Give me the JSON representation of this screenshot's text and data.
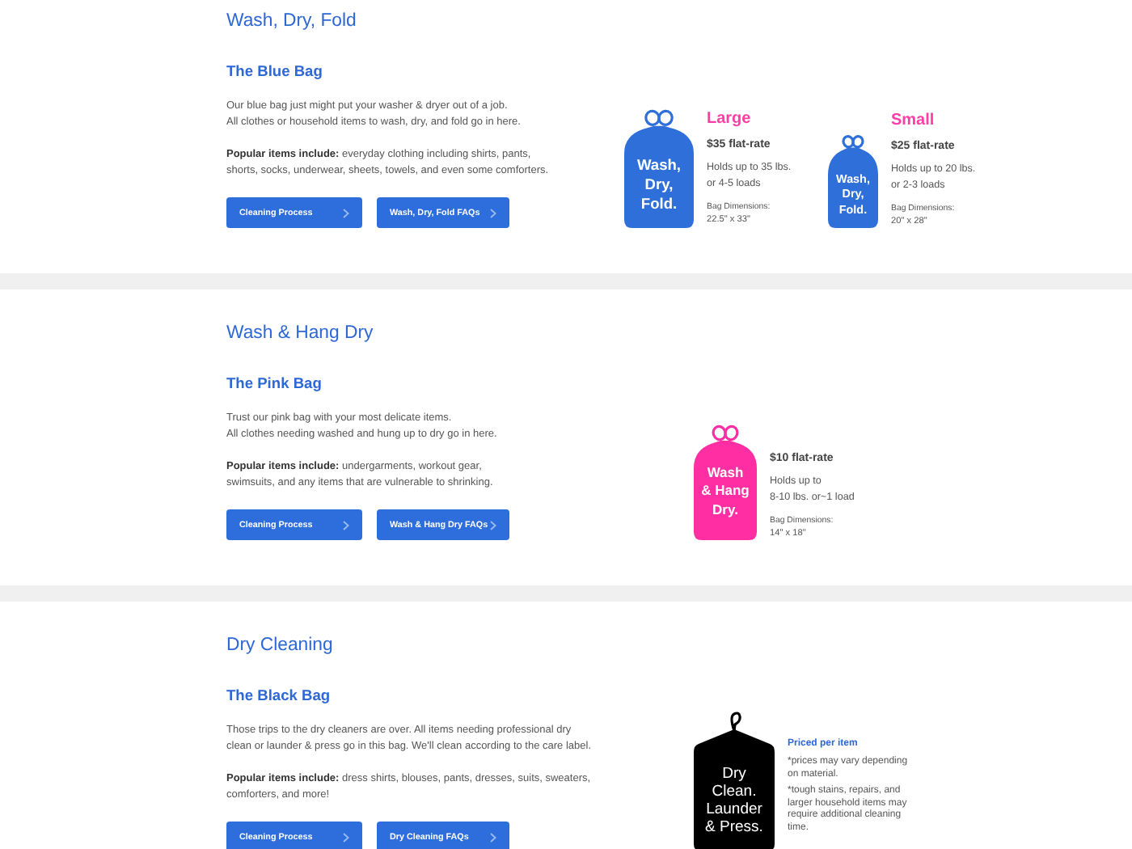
{
  "sections": [
    {
      "title": "Wash, Dry, Fold",
      "subtitle": "The Blue Bag",
      "description": "Our blue bag just might put your washer & dryer out of a job.\nAll clothes or household items to wash, dry, and fold go in here.",
      "popular": "**Popular items include:** everyday clothing including shirts, pants,\nshorts, socks, underwear, sheets, towels, and even some comforters.",
      "buttons": [
        "Cleaning Process",
        "Wash, Dry, Fold FAQs"
      ],
      "bags": [
        {
          "kind": "bag-large",
          "color": "#2e6fd9",
          "label": "Wash,\nDry,\nFold.",
          "size": "Large",
          "price": "$35 flat-rate",
          "holds": "Holds up to 35 lbs.\nor 4-5 loads",
          "dims_label": "Bag Dimensions:",
          "dims": "22.5\" x 33\""
        },
        {
          "kind": "bag-small",
          "color": "#2e6fd9",
          "label": "Wash,\nDry,\nFold.",
          "size": "Small",
          "price": "$25 flat-rate",
          "holds": "Holds up to 20 lbs.\nor 2-3 loads",
          "dims_label": "Bag Dimensions:",
          "dims": "20\" x 28\""
        }
      ]
    },
    {
      "title": "Wash & Hang Dry",
      "subtitle": "The Pink Bag",
      "description": "Trust our pink bag with your most delicate items.\nAll clothes needing washed and hung up to dry go in here.",
      "popular": "**Popular items include:** undergarments, workout gear,\nswimsuits, and any items that are vulnerable to shrinking.",
      "buttons": [
        "Cleaning Process",
        "Wash & Hang Dry FAQs"
      ],
      "bags": [
        {
          "kind": "bag-medium",
          "color": "#ff2fa3",
          "label": "Wash\n& Hang\nDry.",
          "price": "$10 flat-rate",
          "holds": "Holds up to\n8-10 lbs. or~1 load",
          "dims_label": "Bag Dimensions:",
          "dims": "14\" x 18\""
        }
      ]
    },
    {
      "title": "Dry Cleaning",
      "subtitle": "The Black Bag",
      "description": "Those trips to the dry cleaners are over. All items needing professional dry\nclean or launder & press go in this bag. We'll clean according to the care label.",
      "popular": "**Popular items include:** dress shirts, blouses, pants, dresses, suits, sweaters,\ncomforters, and more!",
      "buttons": [
        "Cleaning Process",
        "Dry Cleaning FAQs"
      ],
      "bags": [
        {
          "kind": "garment",
          "color": "#000000",
          "label": "Dry\nClean.\nLaunder\n& Press.",
          "price_link": "Priced per item",
          "notes": [
            "*prices may vary depending\non material.",
            "*tough stains, repairs, and\nlarger household items may\nrequire additional cleaning\ntime."
          ]
        }
      ]
    }
  ]
}
